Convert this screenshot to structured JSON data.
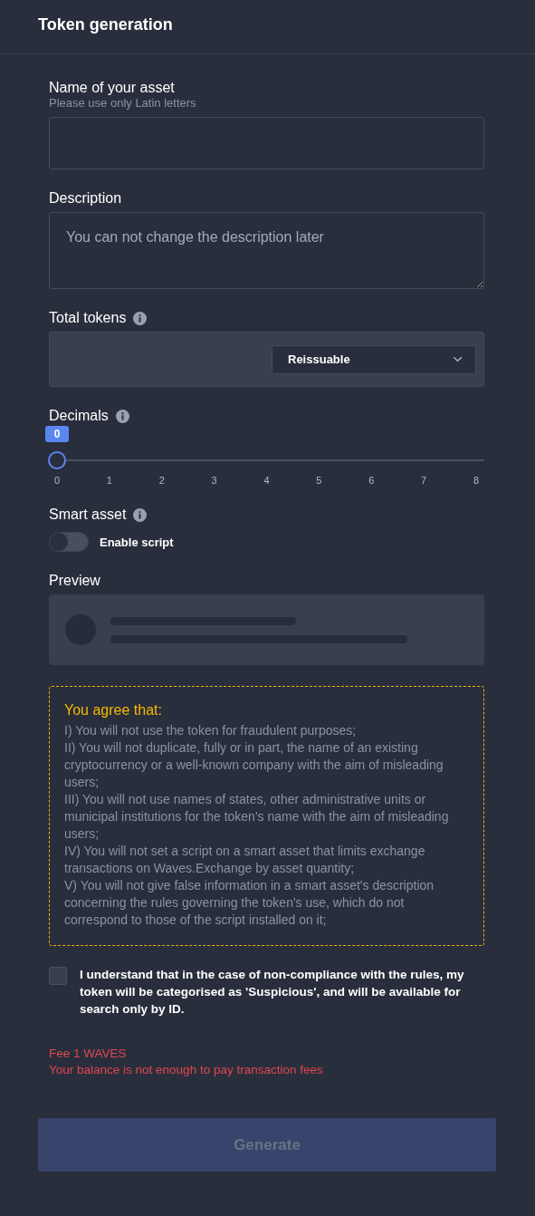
{
  "header": {
    "title": "Token generation"
  },
  "fields": [
    {
      "kind": "text",
      "label": "Name of your asset",
      "hint": "Please use only Latin letters"
    },
    {
      "kind": "textarea",
      "label": "Description",
      "placeholder": "You can not change the description later"
    }
  ],
  "total_tokens": {
    "label": "Total tokens",
    "select": {
      "value": "Reissuable"
    }
  },
  "decimals": {
    "label": "Decimals",
    "reading": "0",
    "level": 0,
    "ticks": [
      "0",
      "1",
      "2",
      "3",
      "4",
      "5",
      "6",
      "7",
      "8"
    ]
  },
  "smart_asset": {
    "label": "Smart asset",
    "toggle": {
      "label": "Enable script",
      "on": false
    }
  },
  "preview": {
    "label": "Preview"
  },
  "agreement": {
    "title": "You agree that:",
    "rules": [
      "I) You will not use the token for fraudulent purposes;",
      "II) You will not duplicate, fully or in part, the name of an existing cryptocurrency or a well-known company with the aim of misleading users;",
      "III) You will not use names of states, other administrative units or municipal institutions for the token's name with the aim of misleading users;",
      "IV) You will not set a script on a smart asset that limits exchange transactions on Waves.Exchange by asset quantity;",
      "V) You will not give false information in a smart asset's description concerning the rules governing the token's use, which do not correspond to those of the script installed on it;"
    ]
  },
  "confirm": {
    "label": "I understand that in the case of non-compliance with the rules, my token will be categorised as 'Suspicious', and will be available for search only by ID.",
    "checked": false
  },
  "fee": {
    "text": "Fee 1 WAVES",
    "error": "Your balance is not enough to pay transaction fees"
  },
  "generate_button": {
    "label": "Generate",
    "disabled": true
  }
}
